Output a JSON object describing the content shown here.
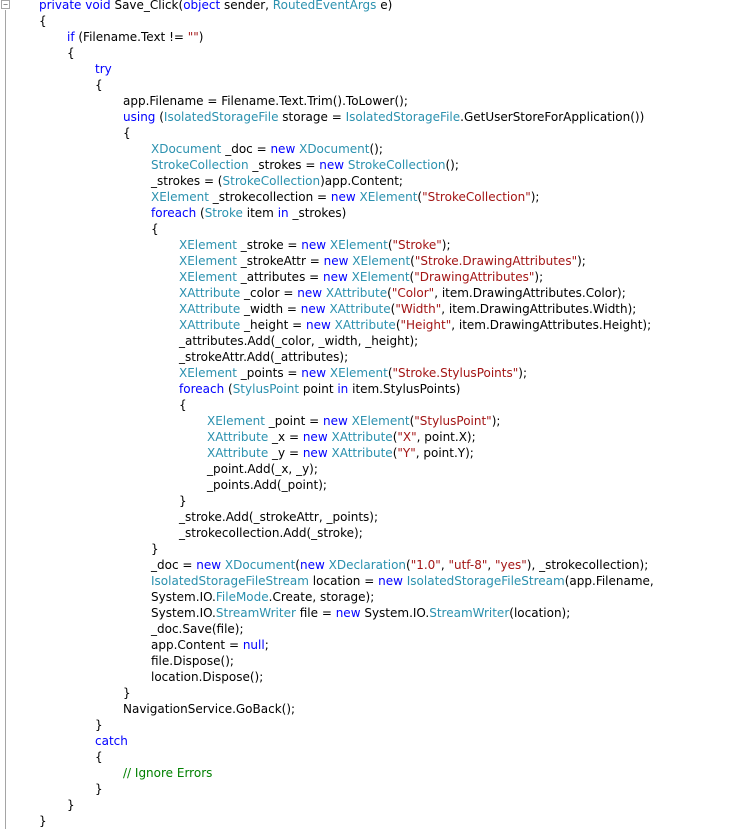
{
  "editor": {
    "collapse_glyph": "−",
    "colors": {
      "keyword": "#0000ff",
      "type": "#2b91af",
      "string": "#a31515",
      "comment": "#008000",
      "plain": "#000000"
    },
    "lines": [
      {
        "indent": 1,
        "segments": [
          {
            "k": "kw",
            "t": "private void"
          },
          {
            "k": "pl",
            "t": " Save_Click("
          },
          {
            "k": "kw",
            "t": "object"
          },
          {
            "k": "pl",
            "t": " sender, "
          },
          {
            "k": "ty",
            "t": "RoutedEventArgs"
          },
          {
            "k": "pl",
            "t": " e)"
          }
        ]
      },
      {
        "indent": 1,
        "segments": [
          {
            "k": "pl",
            "t": "{"
          }
        ]
      },
      {
        "indent": 2,
        "segments": [
          {
            "k": "kw",
            "t": "if"
          },
          {
            "k": "pl",
            "t": " (Filename.Text != "
          },
          {
            "k": "str",
            "t": "\"\""
          },
          {
            "k": "pl",
            "t": ")"
          }
        ]
      },
      {
        "indent": 2,
        "segments": [
          {
            "k": "pl",
            "t": "{"
          }
        ]
      },
      {
        "indent": 3,
        "segments": [
          {
            "k": "kw",
            "t": "try"
          }
        ]
      },
      {
        "indent": 3,
        "segments": [
          {
            "k": "pl",
            "t": "{"
          }
        ]
      },
      {
        "indent": 4,
        "segments": [
          {
            "k": "pl",
            "t": "app.Filename = Filename.Text.Trim().ToLower();"
          }
        ]
      },
      {
        "indent": 4,
        "segments": [
          {
            "k": "kw",
            "t": "using"
          },
          {
            "k": "pl",
            "t": " ("
          },
          {
            "k": "ty",
            "t": "IsolatedStorageFile"
          },
          {
            "k": "pl",
            "t": " storage = "
          },
          {
            "k": "ty",
            "t": "IsolatedStorageFile"
          },
          {
            "k": "pl",
            "t": ".GetUserStoreForApplication())"
          }
        ]
      },
      {
        "indent": 4,
        "segments": [
          {
            "k": "pl",
            "t": "{"
          }
        ]
      },
      {
        "indent": 5,
        "segments": [
          {
            "k": "ty",
            "t": "XDocument"
          },
          {
            "k": "pl",
            "t": " _doc = "
          },
          {
            "k": "kw",
            "t": "new"
          },
          {
            "k": "pl",
            "t": " "
          },
          {
            "k": "ty",
            "t": "XDocument"
          },
          {
            "k": "pl",
            "t": "();"
          }
        ]
      },
      {
        "indent": 5,
        "segments": [
          {
            "k": "ty",
            "t": "StrokeCollection"
          },
          {
            "k": "pl",
            "t": " _strokes = "
          },
          {
            "k": "kw",
            "t": "new"
          },
          {
            "k": "pl",
            "t": " "
          },
          {
            "k": "ty",
            "t": "StrokeCollection"
          },
          {
            "k": "pl",
            "t": "();"
          }
        ]
      },
      {
        "indent": 5,
        "segments": [
          {
            "k": "pl",
            "t": "_strokes = ("
          },
          {
            "k": "ty",
            "t": "StrokeCollection"
          },
          {
            "k": "pl",
            "t": ")app.Content;"
          }
        ]
      },
      {
        "indent": 5,
        "segments": [
          {
            "k": "ty",
            "t": "XElement"
          },
          {
            "k": "pl",
            "t": " _strokecollection = "
          },
          {
            "k": "kw",
            "t": "new"
          },
          {
            "k": "pl",
            "t": " "
          },
          {
            "k": "ty",
            "t": "XElement"
          },
          {
            "k": "pl",
            "t": "("
          },
          {
            "k": "str",
            "t": "\"StrokeCollection\""
          },
          {
            "k": "pl",
            "t": ");"
          }
        ]
      },
      {
        "indent": 5,
        "segments": [
          {
            "k": "kw",
            "t": "foreach"
          },
          {
            "k": "pl",
            "t": " ("
          },
          {
            "k": "ty",
            "t": "Stroke"
          },
          {
            "k": "pl",
            "t": " item "
          },
          {
            "k": "kw",
            "t": "in"
          },
          {
            "k": "pl",
            "t": " _strokes)"
          }
        ]
      },
      {
        "indent": 5,
        "segments": [
          {
            "k": "pl",
            "t": "{"
          }
        ]
      },
      {
        "indent": 6,
        "segments": [
          {
            "k": "ty",
            "t": "XElement"
          },
          {
            "k": "pl",
            "t": " _stroke = "
          },
          {
            "k": "kw",
            "t": "new"
          },
          {
            "k": "pl",
            "t": " "
          },
          {
            "k": "ty",
            "t": "XElement"
          },
          {
            "k": "pl",
            "t": "("
          },
          {
            "k": "str",
            "t": "\"Stroke\""
          },
          {
            "k": "pl",
            "t": ");"
          }
        ]
      },
      {
        "indent": 6,
        "segments": [
          {
            "k": "ty",
            "t": "XElement"
          },
          {
            "k": "pl",
            "t": " _strokeAttr = "
          },
          {
            "k": "kw",
            "t": "new"
          },
          {
            "k": "pl",
            "t": " "
          },
          {
            "k": "ty",
            "t": "XElement"
          },
          {
            "k": "pl",
            "t": "("
          },
          {
            "k": "str",
            "t": "\"Stroke.DrawingAttributes\""
          },
          {
            "k": "pl",
            "t": ");"
          }
        ]
      },
      {
        "indent": 6,
        "segments": [
          {
            "k": "ty",
            "t": "XElement"
          },
          {
            "k": "pl",
            "t": " _attributes = "
          },
          {
            "k": "kw",
            "t": "new"
          },
          {
            "k": "pl",
            "t": " "
          },
          {
            "k": "ty",
            "t": "XElement"
          },
          {
            "k": "pl",
            "t": "("
          },
          {
            "k": "str",
            "t": "\"DrawingAttributes\""
          },
          {
            "k": "pl",
            "t": ");"
          }
        ]
      },
      {
        "indent": 6,
        "segments": [
          {
            "k": "ty",
            "t": "XAttribute"
          },
          {
            "k": "pl",
            "t": " _color = "
          },
          {
            "k": "kw",
            "t": "new"
          },
          {
            "k": "pl",
            "t": " "
          },
          {
            "k": "ty",
            "t": "XAttribute"
          },
          {
            "k": "pl",
            "t": "("
          },
          {
            "k": "str",
            "t": "\"Color\""
          },
          {
            "k": "pl",
            "t": ", item.DrawingAttributes.Color);"
          }
        ]
      },
      {
        "indent": 6,
        "segments": [
          {
            "k": "ty",
            "t": "XAttribute"
          },
          {
            "k": "pl",
            "t": " _width = "
          },
          {
            "k": "kw",
            "t": "new"
          },
          {
            "k": "pl",
            "t": " "
          },
          {
            "k": "ty",
            "t": "XAttribute"
          },
          {
            "k": "pl",
            "t": "("
          },
          {
            "k": "str",
            "t": "\"Width\""
          },
          {
            "k": "pl",
            "t": ", item.DrawingAttributes.Width);"
          }
        ]
      },
      {
        "indent": 6,
        "segments": [
          {
            "k": "ty",
            "t": "XAttribute"
          },
          {
            "k": "pl",
            "t": " _height = "
          },
          {
            "k": "kw",
            "t": "new"
          },
          {
            "k": "pl",
            "t": " "
          },
          {
            "k": "ty",
            "t": "XAttribute"
          },
          {
            "k": "pl",
            "t": "("
          },
          {
            "k": "str",
            "t": "\"Height\""
          },
          {
            "k": "pl",
            "t": ", item.DrawingAttributes.Height);"
          }
        ]
      },
      {
        "indent": 6,
        "segments": [
          {
            "k": "pl",
            "t": "_attributes.Add(_color, _width, _height);"
          }
        ]
      },
      {
        "indent": 6,
        "segments": [
          {
            "k": "pl",
            "t": "_strokeAttr.Add(_attributes);"
          }
        ]
      },
      {
        "indent": 6,
        "segments": [
          {
            "k": "ty",
            "t": "XElement"
          },
          {
            "k": "pl",
            "t": " _points = "
          },
          {
            "k": "kw",
            "t": "new"
          },
          {
            "k": "pl",
            "t": " "
          },
          {
            "k": "ty",
            "t": "XElement"
          },
          {
            "k": "pl",
            "t": "("
          },
          {
            "k": "str",
            "t": "\"Stroke.StylusPoints\""
          },
          {
            "k": "pl",
            "t": ");"
          }
        ]
      },
      {
        "indent": 6,
        "segments": [
          {
            "k": "kw",
            "t": "foreach"
          },
          {
            "k": "pl",
            "t": " ("
          },
          {
            "k": "ty",
            "t": "StylusPoint"
          },
          {
            "k": "pl",
            "t": " point "
          },
          {
            "k": "kw",
            "t": "in"
          },
          {
            "k": "pl",
            "t": " item.StylusPoints)"
          }
        ]
      },
      {
        "indent": 6,
        "segments": [
          {
            "k": "pl",
            "t": "{"
          }
        ]
      },
      {
        "indent": 7,
        "segments": [
          {
            "k": "ty",
            "t": "XElement"
          },
          {
            "k": "pl",
            "t": " _point = "
          },
          {
            "k": "kw",
            "t": "new"
          },
          {
            "k": "pl",
            "t": " "
          },
          {
            "k": "ty",
            "t": "XElement"
          },
          {
            "k": "pl",
            "t": "("
          },
          {
            "k": "str",
            "t": "\"StylusPoint\""
          },
          {
            "k": "pl",
            "t": ");"
          }
        ]
      },
      {
        "indent": 7,
        "segments": [
          {
            "k": "ty",
            "t": "XAttribute"
          },
          {
            "k": "pl",
            "t": " _x = "
          },
          {
            "k": "kw",
            "t": "new"
          },
          {
            "k": "pl",
            "t": " "
          },
          {
            "k": "ty",
            "t": "XAttribute"
          },
          {
            "k": "pl",
            "t": "("
          },
          {
            "k": "str",
            "t": "\"X\""
          },
          {
            "k": "pl",
            "t": ", point.X);"
          }
        ]
      },
      {
        "indent": 7,
        "segments": [
          {
            "k": "ty",
            "t": "XAttribute"
          },
          {
            "k": "pl",
            "t": " _y = "
          },
          {
            "k": "kw",
            "t": "new"
          },
          {
            "k": "pl",
            "t": " "
          },
          {
            "k": "ty",
            "t": "XAttribute"
          },
          {
            "k": "pl",
            "t": "("
          },
          {
            "k": "str",
            "t": "\"Y\""
          },
          {
            "k": "pl",
            "t": ", point.Y);"
          }
        ]
      },
      {
        "indent": 7,
        "segments": [
          {
            "k": "pl",
            "t": "_point.Add(_x, _y);"
          }
        ]
      },
      {
        "indent": 7,
        "segments": [
          {
            "k": "pl",
            "t": "_points.Add(_point);"
          }
        ]
      },
      {
        "indent": 6,
        "segments": [
          {
            "k": "pl",
            "t": "}"
          }
        ]
      },
      {
        "indent": 6,
        "segments": [
          {
            "k": "pl",
            "t": "_stroke.Add(_strokeAttr, _points);"
          }
        ]
      },
      {
        "indent": 6,
        "segments": [
          {
            "k": "pl",
            "t": "_strokecollection.Add(_stroke);"
          }
        ]
      },
      {
        "indent": 5,
        "segments": [
          {
            "k": "pl",
            "t": "}"
          }
        ]
      },
      {
        "indent": 5,
        "segments": [
          {
            "k": "pl",
            "t": "_doc = "
          },
          {
            "k": "kw",
            "t": "new"
          },
          {
            "k": "pl",
            "t": " "
          },
          {
            "k": "ty",
            "t": "XDocument"
          },
          {
            "k": "pl",
            "t": "("
          },
          {
            "k": "kw",
            "t": "new"
          },
          {
            "k": "pl",
            "t": " "
          },
          {
            "k": "ty",
            "t": "XDeclaration"
          },
          {
            "k": "pl",
            "t": "("
          },
          {
            "k": "str",
            "t": "\"1.0\""
          },
          {
            "k": "pl",
            "t": ", "
          },
          {
            "k": "str",
            "t": "\"utf-8\""
          },
          {
            "k": "pl",
            "t": ", "
          },
          {
            "k": "str",
            "t": "\"yes\""
          },
          {
            "k": "pl",
            "t": "), _strokecollection);"
          }
        ]
      },
      {
        "indent": 5,
        "segments": [
          {
            "k": "ty",
            "t": "IsolatedStorageFileStream"
          },
          {
            "k": "pl",
            "t": " location = "
          },
          {
            "k": "kw",
            "t": "new"
          },
          {
            "k": "pl",
            "t": " "
          },
          {
            "k": "ty",
            "t": "IsolatedStorageFileStream"
          },
          {
            "k": "pl",
            "t": "(app.Filename,"
          }
        ]
      },
      {
        "indent": 5,
        "segments": [
          {
            "k": "pl",
            "t": "System.IO."
          },
          {
            "k": "ty",
            "t": "FileMode"
          },
          {
            "k": "pl",
            "t": ".Create, storage);"
          }
        ]
      },
      {
        "indent": 5,
        "segments": [
          {
            "k": "pl",
            "t": "System.IO."
          },
          {
            "k": "ty",
            "t": "StreamWriter"
          },
          {
            "k": "pl",
            "t": " file = "
          },
          {
            "k": "kw",
            "t": "new"
          },
          {
            "k": "pl",
            "t": " System.IO."
          },
          {
            "k": "ty",
            "t": "StreamWriter"
          },
          {
            "k": "pl",
            "t": "(location);"
          }
        ]
      },
      {
        "indent": 5,
        "segments": [
          {
            "k": "pl",
            "t": "_doc.Save(file);"
          }
        ]
      },
      {
        "indent": 5,
        "segments": [
          {
            "k": "pl",
            "t": "app.Content = "
          },
          {
            "k": "kw",
            "t": "null"
          },
          {
            "k": "pl",
            "t": ";"
          }
        ]
      },
      {
        "indent": 5,
        "segments": [
          {
            "k": "pl",
            "t": "file.Dispose();"
          }
        ]
      },
      {
        "indent": 5,
        "segments": [
          {
            "k": "pl",
            "t": "location.Dispose();"
          }
        ]
      },
      {
        "indent": 4,
        "segments": [
          {
            "k": "pl",
            "t": "}"
          }
        ]
      },
      {
        "indent": 4,
        "segments": [
          {
            "k": "pl",
            "t": "NavigationService.GoBack();"
          }
        ]
      },
      {
        "indent": 3,
        "segments": [
          {
            "k": "pl",
            "t": "}"
          }
        ]
      },
      {
        "indent": 3,
        "segments": [
          {
            "k": "kw",
            "t": "catch"
          }
        ]
      },
      {
        "indent": 3,
        "segments": [
          {
            "k": "pl",
            "t": "{"
          }
        ]
      },
      {
        "indent": 4,
        "segments": [
          {
            "k": "cm",
            "t": "// Ignore Errors"
          }
        ]
      },
      {
        "indent": 3,
        "segments": [
          {
            "k": "pl",
            "t": "}"
          }
        ]
      },
      {
        "indent": 2,
        "segments": [
          {
            "k": "pl",
            "t": "}"
          }
        ]
      },
      {
        "indent": 1,
        "segments": [
          {
            "k": "pl",
            "t": "}"
          }
        ]
      }
    ]
  }
}
